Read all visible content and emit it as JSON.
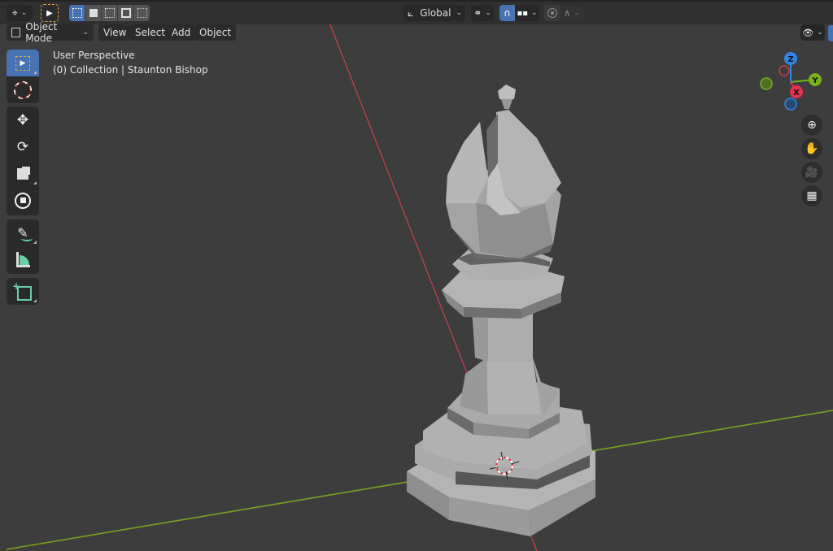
{
  "header": {
    "editor_type_icon": "3d-viewport-icon",
    "select_tool_icon": "select-box-icon",
    "select_modes": [
      {
        "name": "set-new-selection",
        "active": true
      },
      {
        "name": "extend-selection",
        "active": false
      },
      {
        "name": "subtract-selection",
        "active": false
      },
      {
        "name": "invert-selection",
        "active": false
      },
      {
        "name": "intersect-selection",
        "active": false
      }
    ],
    "transform_orientation": "Global",
    "pivot_icon": "pivot-point-icon",
    "snap_icon": "snap-magnet-icon",
    "snap_active": true,
    "snap_target_icon": "snap-increment-icon",
    "proportional_icon": "proportional-edit-icon",
    "falloff_icon": "falloff-curve-icon"
  },
  "menubar": {
    "mode": "Object Mode",
    "menus": [
      "View",
      "Select",
      "Add",
      "Object"
    ],
    "visibility_icon": "object-visibility-icon"
  },
  "viewport": {
    "perspective_label": "User Perspective",
    "collection_label": "(0) Collection | Staunton Bishop",
    "object_name": "Staunton Bishop"
  },
  "toolbar": {
    "groups": [
      [
        {
          "name": "select-box",
          "active": true
        },
        {
          "name": "cursor",
          "active": false
        }
      ],
      [
        {
          "name": "move",
          "active": false
        },
        {
          "name": "rotate",
          "active": false
        },
        {
          "name": "scale",
          "active": false
        },
        {
          "name": "transform",
          "active": false
        }
      ],
      [
        {
          "name": "annotate",
          "active": false
        },
        {
          "name": "measure",
          "active": false
        }
      ],
      [
        {
          "name": "add-cube",
          "active": false
        }
      ]
    ]
  },
  "gizmo": {
    "axes": [
      {
        "label": "Z",
        "color": "#2f86e6"
      },
      {
        "label": "Y",
        "color": "#79b11a"
      },
      {
        "label": "X",
        "color": "#e8304f"
      }
    ]
  },
  "nav_buttons": [
    "zoom",
    "pan",
    "camera",
    "ortho-toggle"
  ],
  "colors": {
    "accent": "#4772b3",
    "x_axis": "#c8414f",
    "y_axis": "#7aa31d",
    "background": "#3d3d3d",
    "mesh": "#a8a8a8"
  }
}
